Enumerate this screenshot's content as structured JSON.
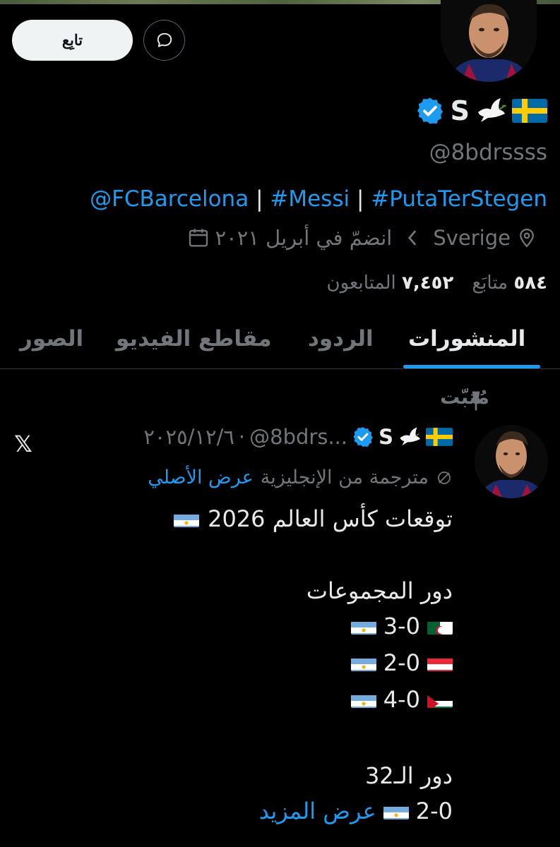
{
  "header": {
    "follow_label": "تابِع"
  },
  "profile": {
    "name": "S",
    "handle": "@8bdrssss",
    "bio": {
      "link1": "@FCBarcelona",
      "link2": "#Messi",
      "link3": "#PutaTerStegen",
      "separator": "|"
    },
    "location": "Sverige",
    "joined": "انضمّ في أبريل ٢٠٢١",
    "following_count": "٥٨٤",
    "following_label": "متابَع",
    "followers_count": "٧,٤٥٢",
    "followers_label": "المتابعون"
  },
  "tabs": [
    {
      "label": "المنشورات",
      "active": true
    },
    {
      "label": "الردود",
      "active": false
    },
    {
      "label": "مقاطع الفيديو",
      "active": false
    },
    {
      "label": "الصور",
      "active": false
    }
  ],
  "pinned": {
    "label": "مُثبّت"
  },
  "post": {
    "author_name": "S",
    "author_handle": "@8bdrs...",
    "date": "٢٠٢٥/١٢/٦",
    "dot": "·",
    "translated_note": "مترجمة من الإنجليزية",
    "show_original": "عرض الأصلي",
    "title": "توقعات كأس العالم 2026",
    "group_stage": "دور المجموعات",
    "scores": [
      {
        "score": "3-0",
        "opponent": "algeria-flag"
      },
      {
        "score": "2-0",
        "opponent": "austria-flag"
      },
      {
        "score": "4-0",
        "opponent": "jordan-flag"
      }
    ],
    "round32": "دور الـ32",
    "round32_score": "2-0",
    "show_more": "عرض المزيد"
  },
  "icons": {
    "verified": "verified-badge-icon",
    "dove": "dove-icon",
    "sweden": "sweden-flag-icon",
    "location": "location-pin-icon",
    "calendar": "calendar-icon",
    "chevron": "chevron-icon",
    "pin": "pin-icon",
    "message": "message-icon",
    "x_logo": "x-logo-icon",
    "translate": "no-translate-icon"
  },
  "colors": {
    "accent": "#1d9bf0",
    "muted": "#71767b",
    "text": "#e7e9ea"
  }
}
